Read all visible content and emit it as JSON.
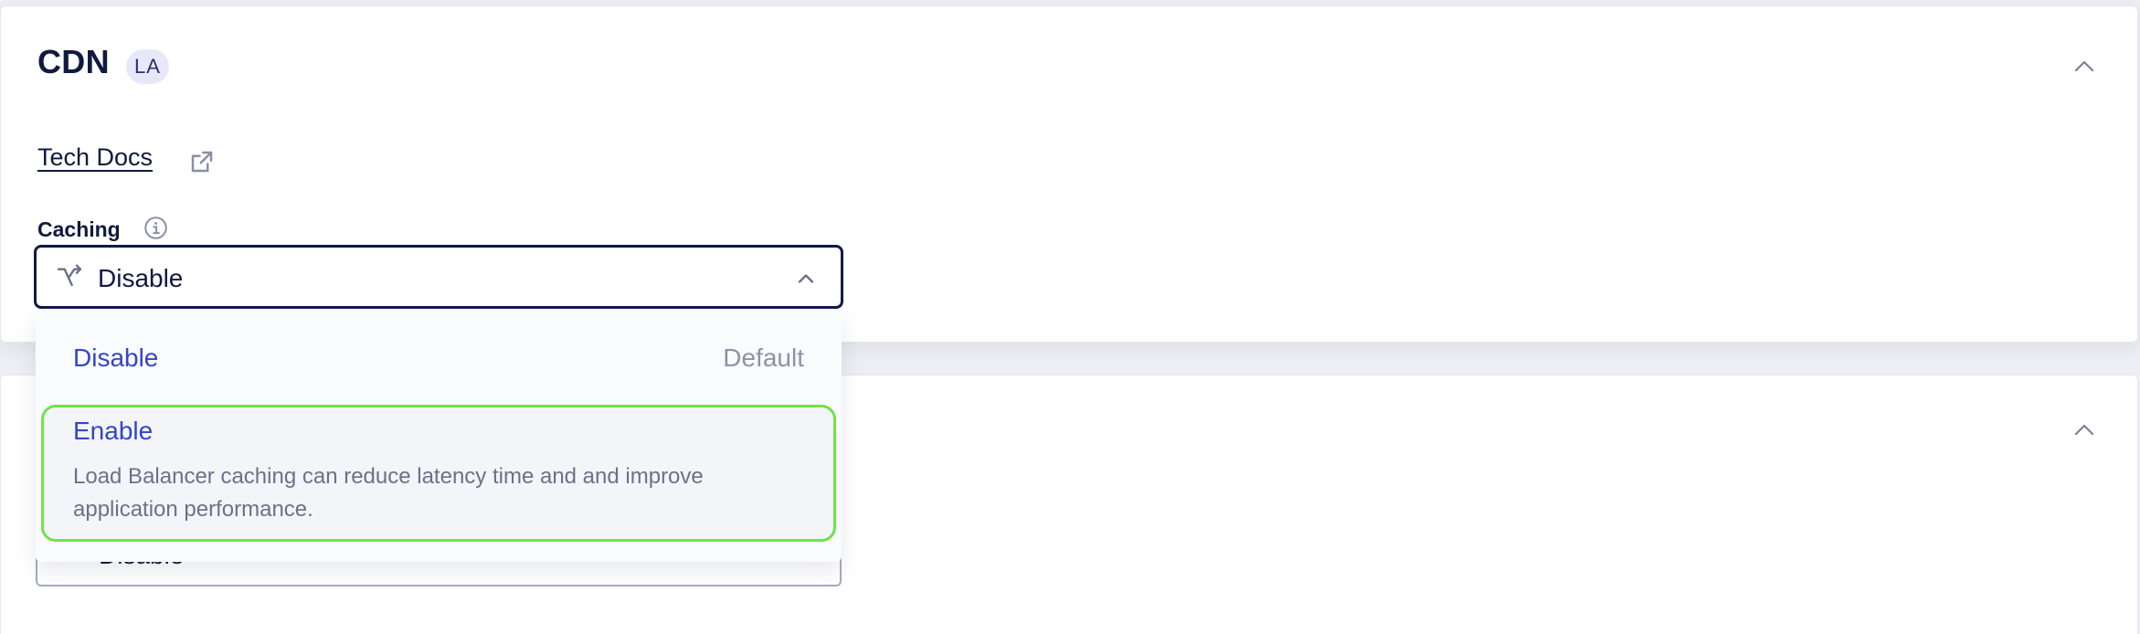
{
  "cdn_card": {
    "title": "CDN",
    "badge": "LA",
    "docs_link": "Tech Docs",
    "caching_label": "Caching",
    "selected_value": "Disable",
    "options": [
      {
        "label": "Disable",
        "hint": "Default"
      },
      {
        "label": "Enable",
        "description": "Load Balancer caching can reduce latency time and and improve application performance."
      }
    ]
  },
  "second_card": {
    "selected_value": "Disable"
  },
  "icons": {
    "collapse": "chevron-up-icon",
    "external": "external-link-icon",
    "info": "info-icon",
    "routing": "route-switch-icon"
  },
  "colors": {
    "text_primary": "#0f1a3f",
    "option_text": "#3346c4",
    "hover_outline": "#6fe34a",
    "badge_bg": "#e9e8fb"
  }
}
